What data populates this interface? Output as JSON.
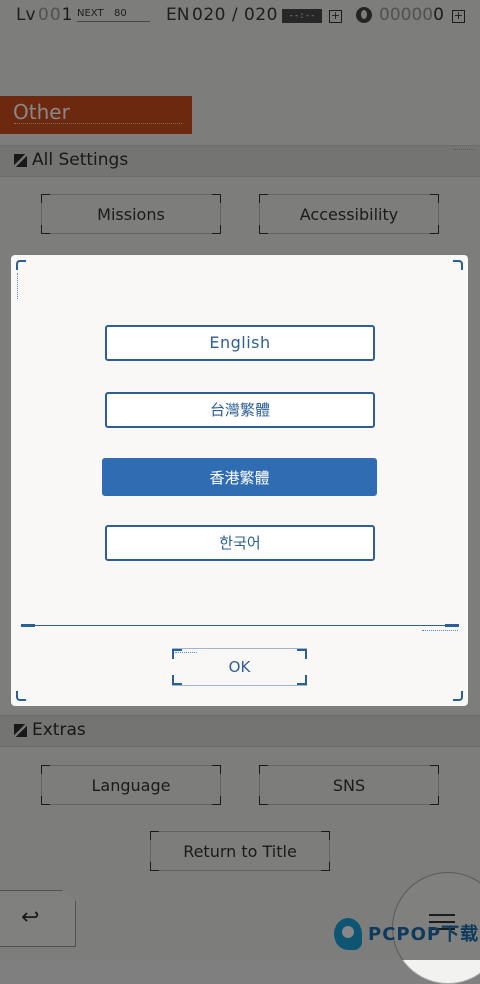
{
  "status": {
    "lv_label": "Lv",
    "lv_dim": "00",
    "lv_value": "1",
    "next_label": "NEXT",
    "next_value": "80",
    "en_label": "EN",
    "en_value": "020 / 020",
    "timer": "--:--",
    "gems_dim": "00000",
    "gems_value": "0"
  },
  "header": {
    "title": "Other"
  },
  "sections": {
    "all_settings": "All Settings",
    "extras": "Extras"
  },
  "menu": {
    "missions": "Missions",
    "accessibility": "Accessibility",
    "language": "Language",
    "sns": "SNS",
    "return_to_title": "Return to Title"
  },
  "dialog": {
    "languages": [
      "English",
      "台灣繁體",
      "香港繁體",
      "한국어"
    ],
    "selected_language": "香港繁體",
    "ok_label": "OK"
  },
  "colors": {
    "accent_orange": "#cf4e1d",
    "dialog_blue": "#2c5f94",
    "selected_blue": "#2f6cb2"
  },
  "watermark": {
    "text": "PCPOP下载"
  }
}
